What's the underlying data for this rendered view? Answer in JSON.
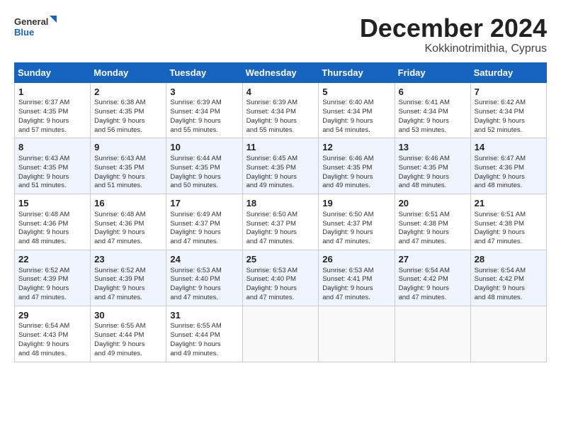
{
  "header": {
    "logo_line1": "General",
    "logo_line2": "Blue",
    "month": "December 2024",
    "location": "Kokkinotrimithia, Cyprus"
  },
  "weekdays": [
    "Sunday",
    "Monday",
    "Tuesday",
    "Wednesday",
    "Thursday",
    "Friday",
    "Saturday"
  ],
  "weeks": [
    [
      {
        "day": "1",
        "lines": [
          "Sunrise: 6:37 AM",
          "Sunset: 4:35 PM",
          "Daylight: 9 hours",
          "and 57 minutes."
        ]
      },
      {
        "day": "2",
        "lines": [
          "Sunrise: 6:38 AM",
          "Sunset: 4:35 PM",
          "Daylight: 9 hours",
          "and 56 minutes."
        ]
      },
      {
        "day": "3",
        "lines": [
          "Sunrise: 6:39 AM",
          "Sunset: 4:34 PM",
          "Daylight: 9 hours",
          "and 55 minutes."
        ]
      },
      {
        "day": "4",
        "lines": [
          "Sunrise: 6:39 AM",
          "Sunset: 4:34 PM",
          "Daylight: 9 hours",
          "and 55 minutes."
        ]
      },
      {
        "day": "5",
        "lines": [
          "Sunrise: 6:40 AM",
          "Sunset: 4:34 PM",
          "Daylight: 9 hours",
          "and 54 minutes."
        ]
      },
      {
        "day": "6",
        "lines": [
          "Sunrise: 6:41 AM",
          "Sunset: 4:34 PM",
          "Daylight: 9 hours",
          "and 53 minutes."
        ]
      },
      {
        "day": "7",
        "lines": [
          "Sunrise: 6:42 AM",
          "Sunset: 4:34 PM",
          "Daylight: 9 hours",
          "and 52 minutes."
        ]
      }
    ],
    [
      {
        "day": "8",
        "lines": [
          "Sunrise: 6:43 AM",
          "Sunset: 4:35 PM",
          "Daylight: 9 hours",
          "and 51 minutes."
        ]
      },
      {
        "day": "9",
        "lines": [
          "Sunrise: 6:43 AM",
          "Sunset: 4:35 PM",
          "Daylight: 9 hours",
          "and 51 minutes."
        ]
      },
      {
        "day": "10",
        "lines": [
          "Sunrise: 6:44 AM",
          "Sunset: 4:35 PM",
          "Daylight: 9 hours",
          "and 50 minutes."
        ]
      },
      {
        "day": "11",
        "lines": [
          "Sunrise: 6:45 AM",
          "Sunset: 4:35 PM",
          "Daylight: 9 hours",
          "and 49 minutes."
        ]
      },
      {
        "day": "12",
        "lines": [
          "Sunrise: 6:46 AM",
          "Sunset: 4:35 PM",
          "Daylight: 9 hours",
          "and 49 minutes."
        ]
      },
      {
        "day": "13",
        "lines": [
          "Sunrise: 6:46 AM",
          "Sunset: 4:35 PM",
          "Daylight: 9 hours",
          "and 48 minutes."
        ]
      },
      {
        "day": "14",
        "lines": [
          "Sunrise: 6:47 AM",
          "Sunset: 4:36 PM",
          "Daylight: 9 hours",
          "and 48 minutes."
        ]
      }
    ],
    [
      {
        "day": "15",
        "lines": [
          "Sunrise: 6:48 AM",
          "Sunset: 4:36 PM",
          "Daylight: 9 hours",
          "and 48 minutes."
        ]
      },
      {
        "day": "16",
        "lines": [
          "Sunrise: 6:48 AM",
          "Sunset: 4:36 PM",
          "Daylight: 9 hours",
          "and 47 minutes."
        ]
      },
      {
        "day": "17",
        "lines": [
          "Sunrise: 6:49 AM",
          "Sunset: 4:37 PM",
          "Daylight: 9 hours",
          "and 47 minutes."
        ]
      },
      {
        "day": "18",
        "lines": [
          "Sunrise: 6:50 AM",
          "Sunset: 4:37 PM",
          "Daylight: 9 hours",
          "and 47 minutes."
        ]
      },
      {
        "day": "19",
        "lines": [
          "Sunrise: 6:50 AM",
          "Sunset: 4:37 PM",
          "Daylight: 9 hours",
          "and 47 minutes."
        ]
      },
      {
        "day": "20",
        "lines": [
          "Sunrise: 6:51 AM",
          "Sunset: 4:38 PM",
          "Daylight: 9 hours",
          "and 47 minutes."
        ]
      },
      {
        "day": "21",
        "lines": [
          "Sunrise: 6:51 AM",
          "Sunset: 4:38 PM",
          "Daylight: 9 hours",
          "and 47 minutes."
        ]
      }
    ],
    [
      {
        "day": "22",
        "lines": [
          "Sunrise: 6:52 AM",
          "Sunset: 4:39 PM",
          "Daylight: 9 hours",
          "and 47 minutes."
        ]
      },
      {
        "day": "23",
        "lines": [
          "Sunrise: 6:52 AM",
          "Sunset: 4:39 PM",
          "Daylight: 9 hours",
          "and 47 minutes."
        ]
      },
      {
        "day": "24",
        "lines": [
          "Sunrise: 6:53 AM",
          "Sunset: 4:40 PM",
          "Daylight: 9 hours",
          "and 47 minutes."
        ]
      },
      {
        "day": "25",
        "lines": [
          "Sunrise: 6:53 AM",
          "Sunset: 4:40 PM",
          "Daylight: 9 hours",
          "and 47 minutes."
        ]
      },
      {
        "day": "26",
        "lines": [
          "Sunrise: 6:53 AM",
          "Sunset: 4:41 PM",
          "Daylight: 9 hours",
          "and 47 minutes."
        ]
      },
      {
        "day": "27",
        "lines": [
          "Sunrise: 6:54 AM",
          "Sunset: 4:42 PM",
          "Daylight: 9 hours",
          "and 47 minutes."
        ]
      },
      {
        "day": "28",
        "lines": [
          "Sunrise: 6:54 AM",
          "Sunset: 4:42 PM",
          "Daylight: 9 hours",
          "and 48 minutes."
        ]
      }
    ],
    [
      {
        "day": "29",
        "lines": [
          "Sunrise: 6:54 AM",
          "Sunset: 4:43 PM",
          "Daylight: 9 hours",
          "and 48 minutes."
        ]
      },
      {
        "day": "30",
        "lines": [
          "Sunrise: 6:55 AM",
          "Sunset: 4:44 PM",
          "Daylight: 9 hours",
          "and 49 minutes."
        ]
      },
      {
        "day": "31",
        "lines": [
          "Sunrise: 6:55 AM",
          "Sunset: 4:44 PM",
          "Daylight: 9 hours",
          "and 49 minutes."
        ]
      },
      null,
      null,
      null,
      null
    ]
  ]
}
